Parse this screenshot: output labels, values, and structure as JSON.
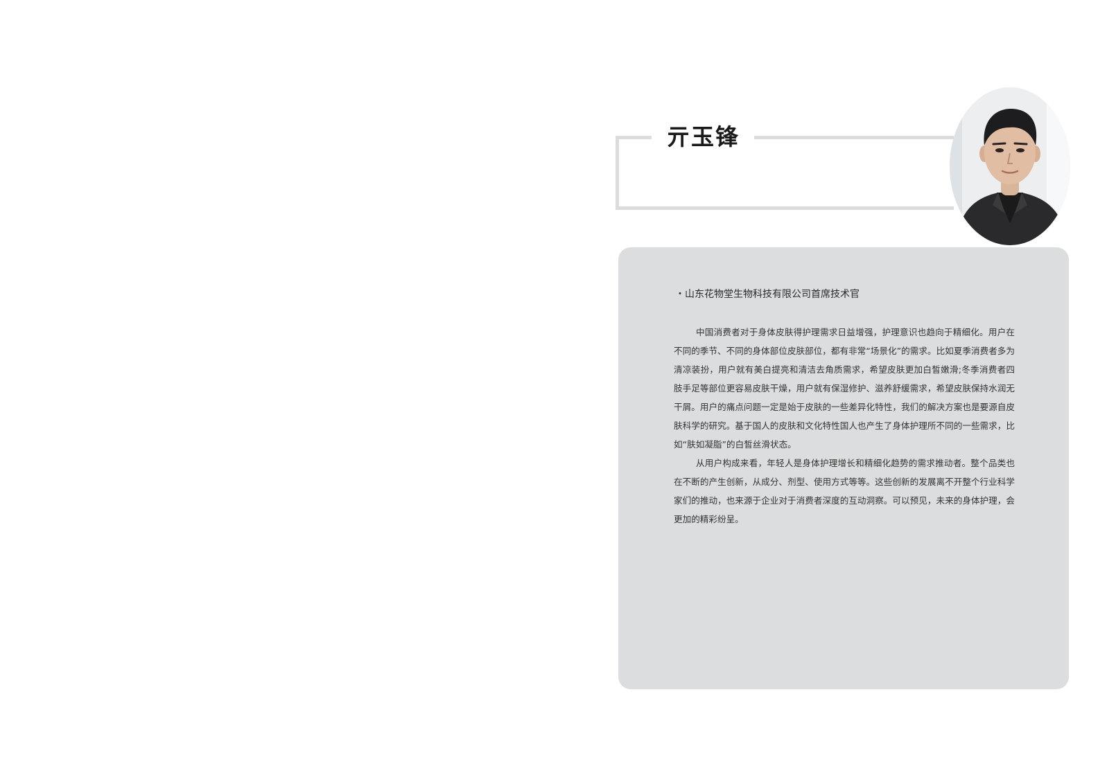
{
  "profile": {
    "name": "亓玉锋",
    "title": "・山东花物堂生物科技有限公司首席技术官",
    "bio": [
      "中国消费者对于身体皮肤得护理需求日益增强，护理意识也趋向于精细化。用户在不同的季节、不同的身体部位皮肤部位，都有非常“场景化”的需求。比如夏季消费者多为清凉装扮，用户就有美白提亮和清洁去角质需求，希望皮肤更加白皙嫩滑;冬季消费者四肢手足等部位更容易皮肤干燥，用户就有保湿修护、滋养舒缓需求，希望皮肤保持水润无干屑。用户的痛点问题一定是始于皮肤的一些差异化特性，我们的解决方案也是要源自皮肤科学的研究。基于国人的皮肤和文化特性国人也产生了身体护理所不同的一些需求，比如“肤如凝脂”的白皙丝滑状态。",
      "从用户构成来看，年轻人是身体护理增长和精细化趋势的需求推动者。整个品类也在不断的产生创新，从成分、剂型、使用方式等等。这些创新的发展离不开整个行业科学家们的推动，也来源于企业对于消费者深度的互动洞察。可以预见，未来的身体护理，会更加的精彩纷呈。"
    ]
  },
  "colors": {
    "frame": "#dcdcdc",
    "card": "#dcddde",
    "text": "#333333"
  }
}
